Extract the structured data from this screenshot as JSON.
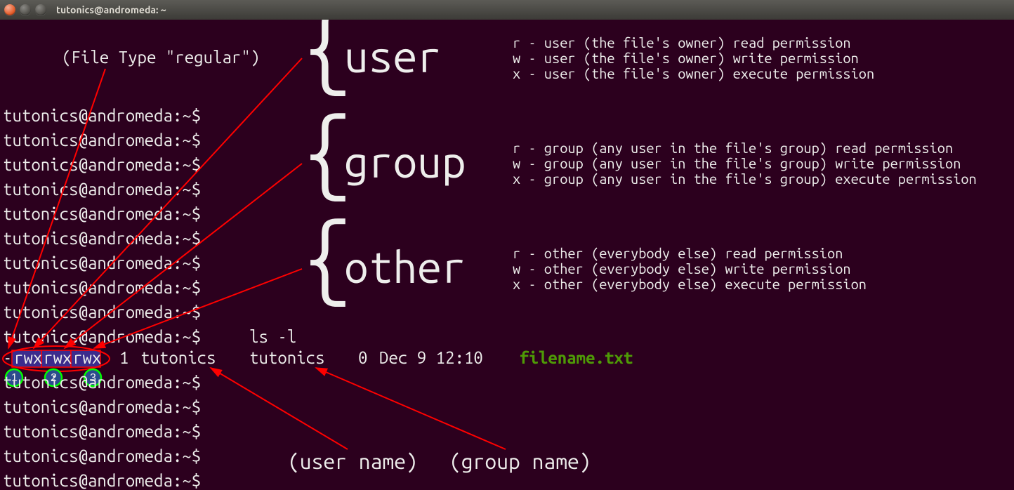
{
  "window": {
    "title": "tutonics@andromeda: ~"
  },
  "filetype_label": "(File Type \"regular\")",
  "sections": {
    "user": {
      "title": "user",
      "r": "r -  user (the file's owner) read permission",
      "w": "w -  user (the file's owner) write permission",
      "x": "x -  user (the file's owner) execute permission"
    },
    "group": {
      "title": "group",
      "r": "r -  group (any user in the file's group) read permission",
      "w": "w -  group (any user in the file's group) write permission",
      "x": "x -  group (any user in the file's group) execute permission"
    },
    "other": {
      "title": "other",
      "r": "r -  other (everybody else) read permission",
      "w": "w -  other (everybody else) write permission",
      "x": "x -  other (everybody else) execute permission"
    }
  },
  "prompt": "tutonics@andromeda:~$",
  "command": "ls -l",
  "ls": {
    "dash": "-",
    "perm1": "rwx",
    "perm2": "rwx",
    "perm3": "rwx",
    "links": "1",
    "user": "tutonics",
    "group": "tutonics",
    "size": "0",
    "date": "Dec  9 12:10",
    "file": "filename.txt"
  },
  "username_label": "(user name)",
  "groupname_label": "(group name)",
  "circles": {
    "one": "1",
    "two": "2",
    "three": "3"
  }
}
